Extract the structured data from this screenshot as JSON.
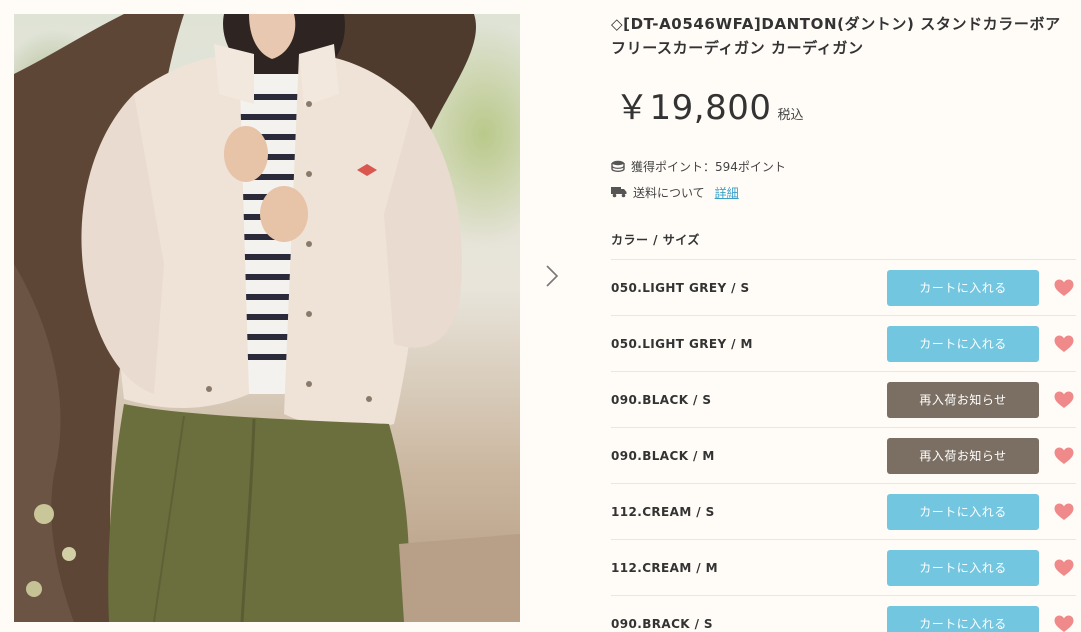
{
  "product": {
    "title": "◇[DT-A0546WFA]DANTON(ダントン) スタンドカラーボアフリースカーディガン カーディガン",
    "price": "￥19,800",
    "tax_label": "税込"
  },
  "meta": {
    "points_text": "獲得ポイント：594ポイント",
    "shipping_text": "送料について",
    "shipping_link": "詳細"
  },
  "variants_header": "カラー / サイズ",
  "variants": [
    {
      "name": "050.LIGHT GREY / S",
      "button": "カートに入れる",
      "type": "cart"
    },
    {
      "name": "050.LIGHT GREY / M",
      "button": "カートに入れる",
      "type": "cart"
    },
    {
      "name": "090.BLACK / S",
      "button": "再入荷お知らせ",
      "type": "restock"
    },
    {
      "name": "090.BLACK / M",
      "button": "再入荷お知らせ",
      "type": "restock"
    },
    {
      "name": "112.CREAM / S",
      "button": "カートに入れる",
      "type": "cart"
    },
    {
      "name": "112.CREAM / M",
      "button": "カートに入れる",
      "type": "cart"
    },
    {
      "name": "090.BRACK / S",
      "button": "カートに入れる",
      "type": "cart"
    }
  ],
  "colors": {
    "cart_button": "#72c6e0",
    "restock_button": "#7b6f63",
    "heart": "#f08a8a",
    "link": "#3aa0c8"
  },
  "icons": {
    "next": "chevron-right-icon",
    "points": "coins-icon",
    "shipping": "truck-icon",
    "favorite": "heart-icon"
  }
}
